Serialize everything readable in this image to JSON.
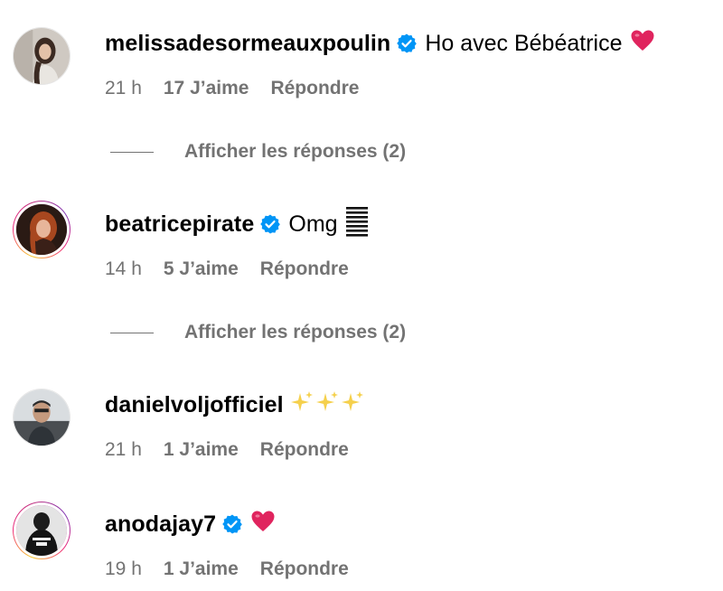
{
  "comments": [
    {
      "username": "melissadesormeauxpoulin",
      "verified": true,
      "text": "Ho avec Bébéatrice",
      "emoji": "red-heart",
      "time": "21 h",
      "likes": "17 J’aime",
      "reply": "Répondre",
      "view_replies": "Afficher les réponses (2)"
    },
    {
      "username": "beatricepirate",
      "verified": true,
      "text": "Omg",
      "emoji": "lines-icon",
      "time": "14 h",
      "likes": "5 J’aime",
      "reply": "Répondre",
      "view_replies": "Afficher les réponses (2)"
    },
    {
      "username": "danielvoljofficiel",
      "verified": false,
      "text": "",
      "emoji": "sparkles-x3",
      "time": "21 h",
      "likes": "1 J’aime",
      "reply": "Répondre"
    },
    {
      "username": "anodajay7",
      "verified": true,
      "text": "",
      "emoji": "red-heart",
      "time": "19 h",
      "likes": "1 J’aime",
      "reply": "Répondre"
    }
  ],
  "colors": {
    "secondary_text": "#737373",
    "verified_blue": "#0095f6",
    "heart_red": "#e0245e"
  }
}
